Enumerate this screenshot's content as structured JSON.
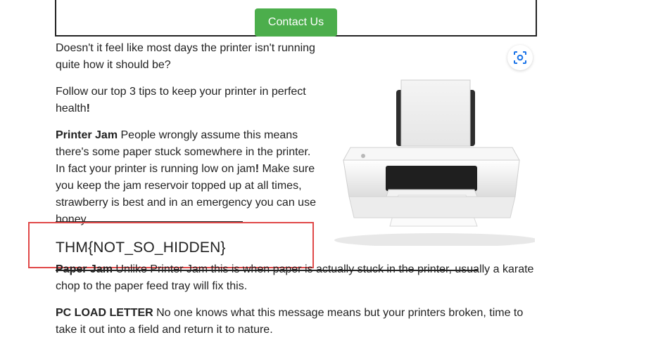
{
  "header": {
    "contact_label": "Contact Us"
  },
  "content": {
    "intro1": "Doesn't it feel like most days the printer isn't running quite how it should be?",
    "intro2_text": "Follow our top 3 tips to keep your printer in perfect health",
    "intro2_end": "!",
    "tip1_title": "Printer Jam",
    "tip1_text": " People wrongly assume this means there's some paper stuck somewhere in the printer. In fact your printer is running low on jam",
    "tip1_bang": "!",
    "tip1_text2": " Make sure you keep the jam reservoir topped up at all times, strawberry is best and in an emergency you can use honey.",
    "hidden_flag": "THM{NOT_SO_HIDDEN}",
    "tip2_title": "Paper Jam",
    "tip2_text": " Unlike Printer Jam this is when paper is actually stuck in the printer, usually a karate chop to the paper feed tray will fix this.",
    "tip3_title": "PC LOAD LETTER",
    "tip3_text": " No one knows what this message means but your printers broken, time to take it out into a field and return it to nature."
  },
  "image": {
    "icon": "printer-photo"
  },
  "overlay": {
    "lens_icon": "visual-search-icon"
  }
}
